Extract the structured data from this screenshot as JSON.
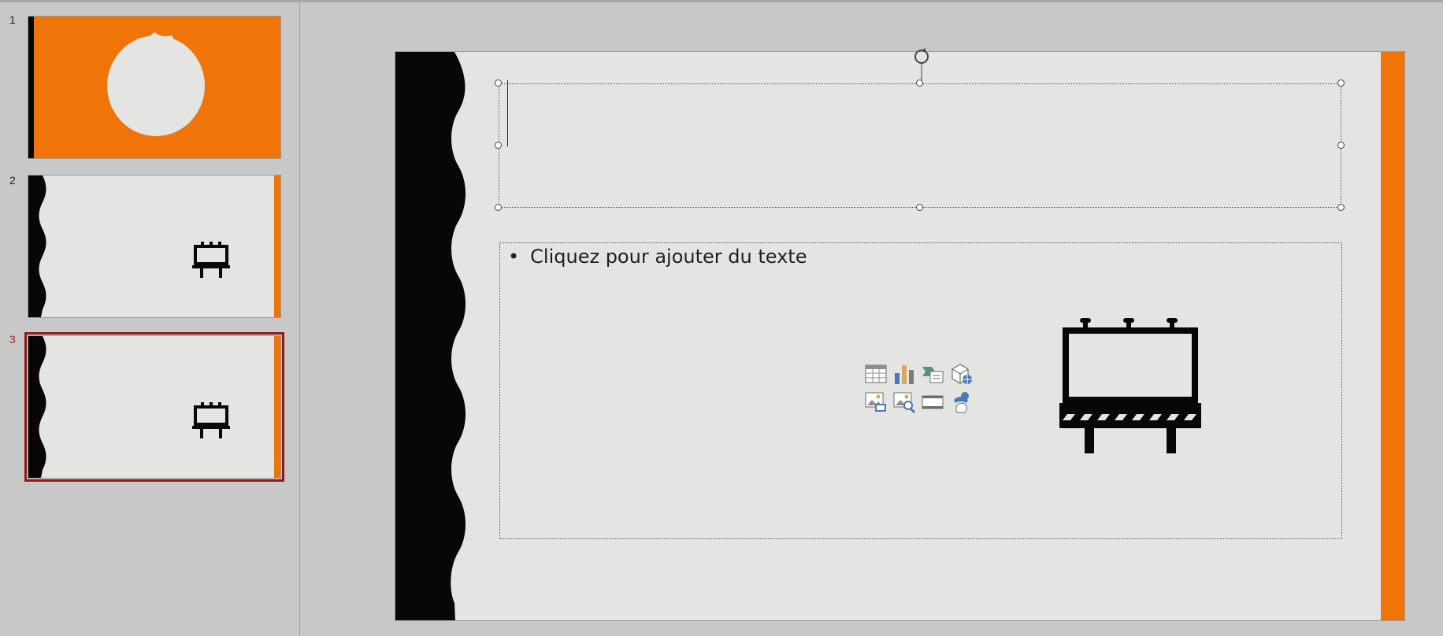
{
  "thumbnails": [
    {
      "number": "1",
      "layout": "title-orange-badge"
    },
    {
      "number": "2",
      "layout": "content-billboard"
    },
    {
      "number": "3",
      "layout": "content-billboard",
      "selected": true
    }
  ],
  "slide": {
    "body_placeholder_text": "Cliquez pour ajouter du texte",
    "bullet": "•"
  },
  "insert_icons": [
    "table-icon",
    "chart-icon",
    "smartart-icon",
    "3d-model-icon",
    "picture-icon",
    "online-picture-icon",
    "video-icon",
    "icons-icon"
  ],
  "colors": {
    "accent_orange": "#f07408",
    "slide_bg": "#e4e4e3",
    "dark": "#080606",
    "selection": "#8b1a1a"
  }
}
